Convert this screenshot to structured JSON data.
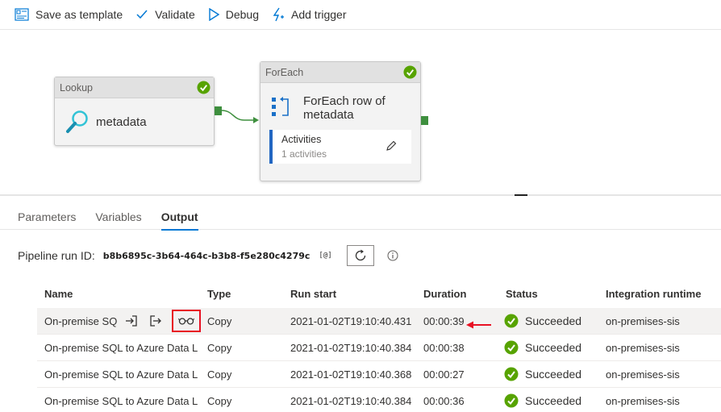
{
  "toolbar": {
    "save_template": "Save as template",
    "validate": "Validate",
    "debug": "Debug",
    "add_trigger": "Add trigger"
  },
  "canvas": {
    "lookup": {
      "header": "Lookup",
      "label": "metadata"
    },
    "foreach": {
      "header": "ForEach",
      "title": "ForEach row of metadata",
      "activities_title": "Activities",
      "activities_count": "1 activities"
    }
  },
  "tabs": [
    "Parameters",
    "Variables",
    "Output"
  ],
  "active_tab": "Output",
  "run": {
    "label": "Pipeline run ID:",
    "id": "b8b6895c-3b64-464c-b3b8-f5e280c4279c",
    "copy_glyph": "[@]"
  },
  "table": {
    "headers": [
      "Name",
      "Type",
      "Run start",
      "Duration",
      "Status",
      "Integration runtime"
    ],
    "rows": [
      {
        "name": "On-premise SQ",
        "type": "Copy",
        "run_start": "2021-01-02T19:10:40.431",
        "duration": "00:00:39",
        "status": "Succeeded",
        "ir": "on-premises-sis"
      },
      {
        "name": "On-premise SQL to Azure Data L",
        "type": "Copy",
        "run_start": "2021-01-02T19:10:40.384",
        "duration": "00:00:38",
        "status": "Succeeded",
        "ir": "on-premises-sis"
      },
      {
        "name": "On-premise SQL to Azure Data L",
        "type": "Copy",
        "run_start": "2021-01-02T19:10:40.368",
        "duration": "00:00:27",
        "status": "Succeeded",
        "ir": "on-premises-sis"
      },
      {
        "name": "On-premise SQL to Azure Data L",
        "type": "Copy",
        "run_start": "2021-01-02T19:10:40.384",
        "duration": "00:00:36",
        "status": "Succeeded",
        "ir": "on-premises-sis"
      }
    ]
  },
  "colors": {
    "accent": "#0078d4",
    "success": "#57a300",
    "highlight_box": "#e81123",
    "port": "#3e8f3e"
  }
}
